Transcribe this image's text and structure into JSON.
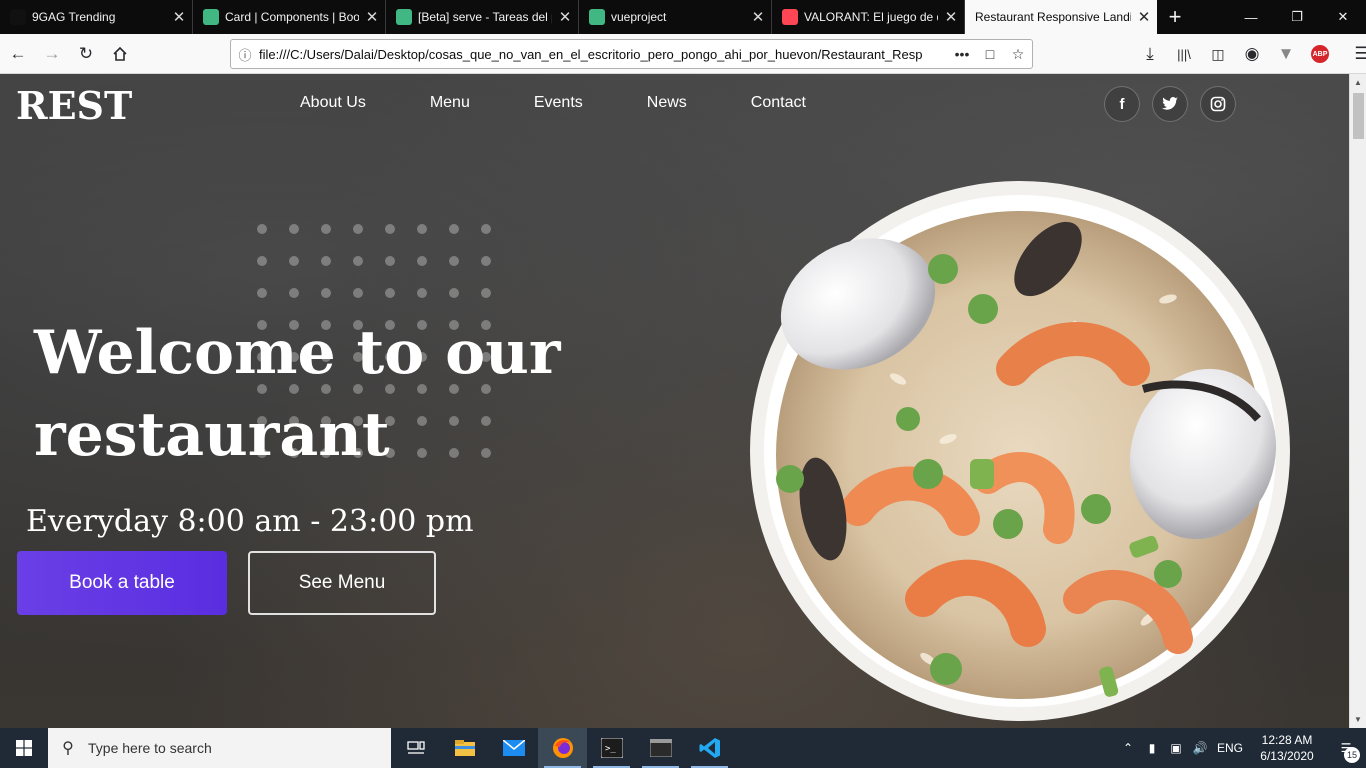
{
  "browser": {
    "tabs": [
      {
        "title": "9GAG Trending",
        "favicon": "9gag-icon",
        "favicon_color": "#111111",
        "active": false
      },
      {
        "title": "Card | Components | Boo",
        "favicon": "bootstrap-vue-icon",
        "favicon_color": "#41b883",
        "active": false
      },
      {
        "title": "[Beta] serve - Tareas del p",
        "favicon": "vue-icon",
        "favicon_color": "#41b883",
        "active": false
      },
      {
        "title": "vueproject",
        "favicon": "vue-icon",
        "favicon_color": "#41b883",
        "active": false
      },
      {
        "title": "VALORANT: El juego de d",
        "favicon": "valorant-icon",
        "favicon_color": "#ff4655",
        "active": false
      },
      {
        "title": "Restaurant Responsive Landin",
        "favicon": "",
        "favicon_color": "",
        "active": true
      }
    ],
    "url": "file:///C:/Users/Dalai/Desktop/cosas_que_no_van_en_el_escritorio_pero_pongo_ahi_por_huevon/Restaurant_Resp"
  },
  "page": {
    "logo": "REST",
    "nav": [
      "About Us",
      "Menu",
      "Events",
      "News",
      "Contact"
    ],
    "social": [
      {
        "name": "facebook-icon",
        "glyph": "f"
      },
      {
        "name": "twitter-icon",
        "glyph": "🐦"
      },
      {
        "name": "instagram-icon",
        "glyph": "◎"
      }
    ],
    "headline": "Welcome to our restaurant",
    "hours": "Everyday 8:00 am - 23:00 pm",
    "book_button": "Book a table",
    "menu_button": "See Menu",
    "accent_color": "#5a2ee0"
  },
  "taskbar": {
    "search_placeholder": "Type here to search",
    "language": "ENG",
    "time": "12:28 AM",
    "date": "6/13/2020",
    "notification_count": "15"
  }
}
